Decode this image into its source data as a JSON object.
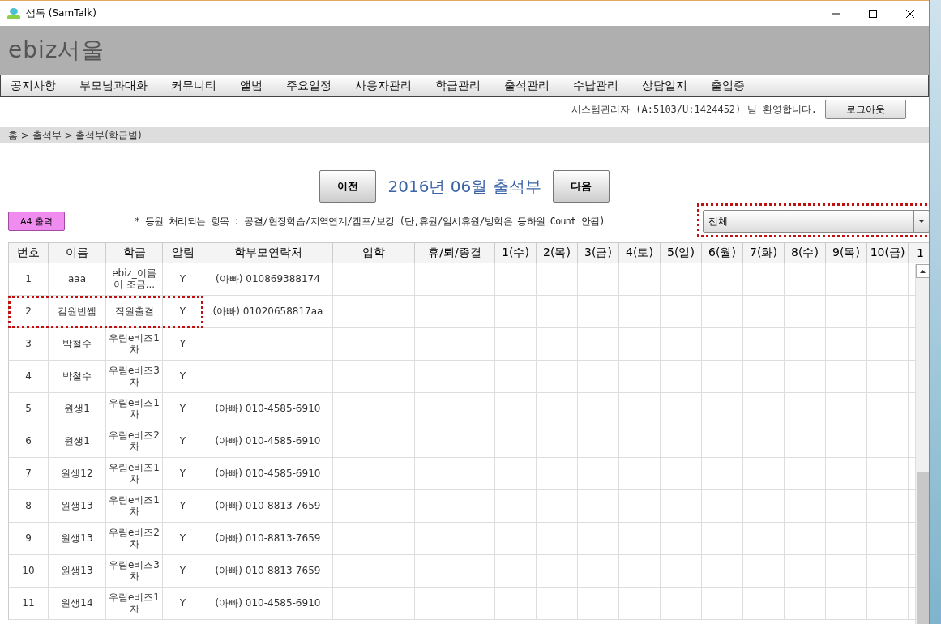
{
  "window": {
    "title": "샘톡 (SamTalk)"
  },
  "header": {
    "title": "ebiz서울"
  },
  "menu": [
    "공지사항",
    "부모님과대화",
    "커뮤니티",
    "앨범",
    "주요일정",
    "사용자관리",
    "학급관리",
    "출석관리",
    "수납관리",
    "상담일지",
    "출입증"
  ],
  "user_bar": {
    "welcome": "시스템관리자 (A:5103/U:1424452) 님 환영합니다.",
    "logout": "로그아웃"
  },
  "breadcrumb": "홈 > 출석부 > 출석부(학급별)",
  "period": {
    "prev": "이전",
    "title": "2016년 06월 출석부",
    "next": "다음"
  },
  "print_button": "A4 출력",
  "note": "* 등원 처리되는 항목 : 공결/현장학습/지역연계/캠프/보강 (단,휴원/임시휴원/방학은 등하원 Count 안됨)",
  "filter": {
    "value": "전체",
    "highlighted": true
  },
  "table": {
    "columns": [
      "번호",
      "이름",
      "학급",
      "알림",
      "학부모연락처",
      "입학",
      "휴/퇴/종결",
      "1(수)",
      "2(목)",
      "3(금)",
      "4(토)",
      "5(일)",
      "6(월)",
      "7(화)",
      "8(수)",
      "9(목)",
      "10(금)",
      "1"
    ],
    "rows": [
      {
        "no": "1",
        "name": "aaa",
        "class": "ebiz_이름이 조금...",
        "alert": "Y",
        "contact": "(아빠) 010869388174",
        "highlighted": false
      },
      {
        "no": "2",
        "name": "김원빈쌤",
        "class": "직원출결",
        "alert": "Y",
        "contact": "(아빠) 01020658817aa",
        "highlighted": true
      },
      {
        "no": "3",
        "name": "박철수",
        "class": "우림e비즈1차",
        "alert": "Y",
        "highlighted": false
      },
      {
        "no": "4",
        "name": "박철수",
        "class": "우림e비즈3차",
        "alert": "Y",
        "highlighted": false
      },
      {
        "no": "5",
        "name": "원생1",
        "class": "우림e비즈1차",
        "alert": "Y",
        "contact": "(아빠) 010-4585-6910",
        "highlighted": false
      },
      {
        "no": "6",
        "name": "원생1",
        "class": "우림e비즈2차",
        "alert": "Y",
        "contact": "(아빠) 010-4585-6910",
        "highlighted": false
      },
      {
        "no": "7",
        "name": "원생12",
        "class": "우림e비즈1차",
        "alert": "Y",
        "contact": "(아빠) 010-4585-6910",
        "highlighted": false
      },
      {
        "no": "8",
        "name": "원생13",
        "class": "우림e비즈1차",
        "alert": "Y",
        "contact": "(아빠) 010-8813-7659",
        "highlighted": false
      },
      {
        "no": "9",
        "name": "원생13",
        "class": "우림e비즈2차",
        "alert": "Y",
        "contact": "(아빠) 010-8813-7659",
        "highlighted": false
      },
      {
        "no": "10",
        "name": "원생13",
        "class": "우림e비즈3차",
        "alert": "Y",
        "contact": "(아빠) 010-8813-7659",
        "highlighted": false
      },
      {
        "no": "11",
        "name": "원생14",
        "class": "우림e비즈1차",
        "alert": "Y",
        "contact": "(아빠) 010-4585-6910",
        "highlighted": false
      }
    ]
  }
}
